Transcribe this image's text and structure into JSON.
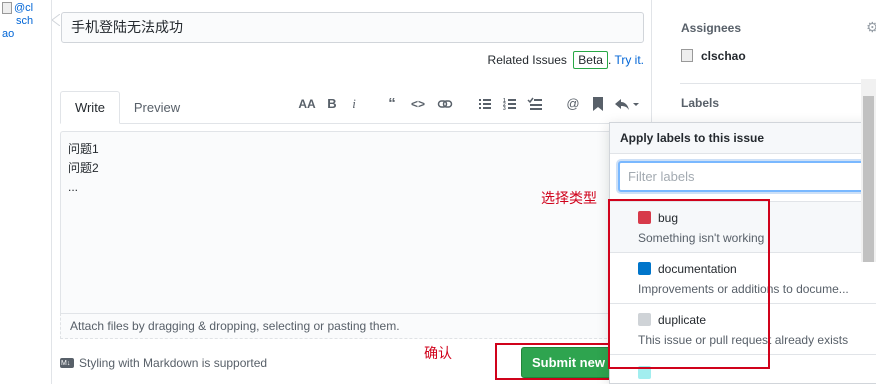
{
  "avatar": {
    "alt_text": "@clschao",
    "alt_lines": [
      "@cl",
      "sch",
      "ao"
    ]
  },
  "issue": {
    "title_value": "手机登陆无法成功",
    "related_issues": {
      "label": "Related Issues",
      "beta": "Beta",
      "separator": ".",
      "try_it": "Try it."
    }
  },
  "editor": {
    "tabs": [
      {
        "label": "Write"
      },
      {
        "label": "Preview"
      }
    ],
    "toolbar": [
      "header-icon",
      "bold-icon",
      "italic-icon",
      "quote-icon",
      "code-icon",
      "link-icon",
      "unordered-list-icon",
      "ordered-list-icon",
      "task-list-icon",
      "mention-icon",
      "saved-reply-icon",
      "reply-icon"
    ],
    "body_value": "问题1\n问题2\n...",
    "attach_hint": "Attach files by dragging & dropping, selecting or pasting them.",
    "markdown_note": "Styling with Markdown is supported",
    "submit_label": "Submit new i"
  },
  "sidebar": {
    "assignees_heading": "Assignees",
    "assignee_name": "clschao",
    "labels_heading": "Labels"
  },
  "labels_dropdown": {
    "header": "Apply labels to this issue",
    "filter_placeholder": "Filter labels",
    "items": [
      {
        "name": "bug",
        "description": "Something isn't working",
        "color": "#d73a4a"
      },
      {
        "name": "documentation",
        "description": "Improvements or additions to docume...",
        "color": "#0075ca"
      },
      {
        "name": "duplicate",
        "description": "This issue or pull request already exists",
        "color": "#cfd3d7"
      }
    ]
  },
  "annotations": {
    "select_type": "选择类型",
    "confirm": "确认",
    "color": "#d0021b"
  }
}
